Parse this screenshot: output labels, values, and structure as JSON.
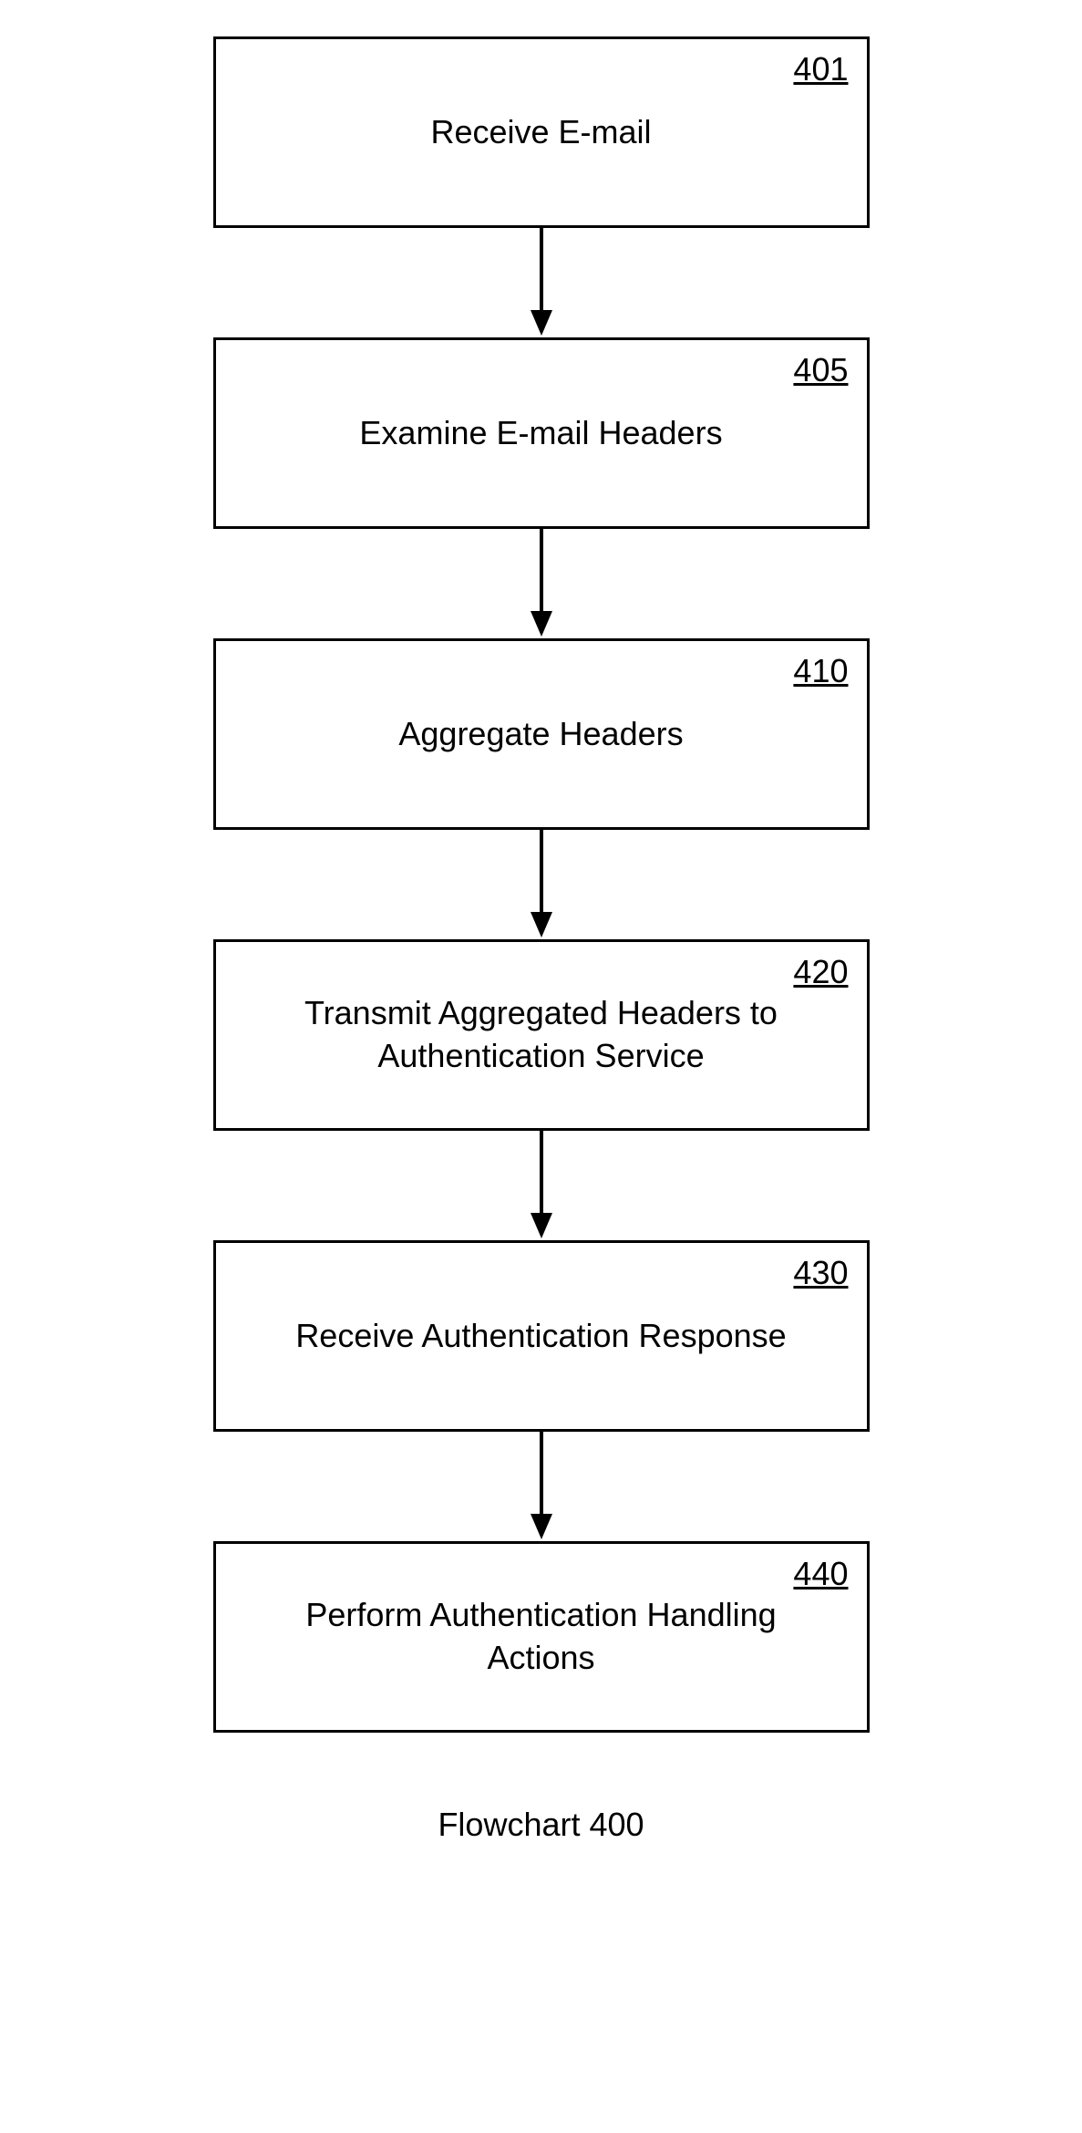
{
  "flowchart": {
    "caption": "Flowchart 400",
    "steps": [
      {
        "number": "401",
        "label": "Receive E-mail"
      },
      {
        "number": "405",
        "label": "Examine E-mail Headers"
      },
      {
        "number": "410",
        "label": "Aggregate Headers"
      },
      {
        "number": "420",
        "label": "Transmit Aggregated Headers to Authentication Service"
      },
      {
        "number": "430",
        "label": "Receive Authentication Response"
      },
      {
        "number": "440",
        "label": "Perform Authentication Handling Actions"
      }
    ]
  }
}
